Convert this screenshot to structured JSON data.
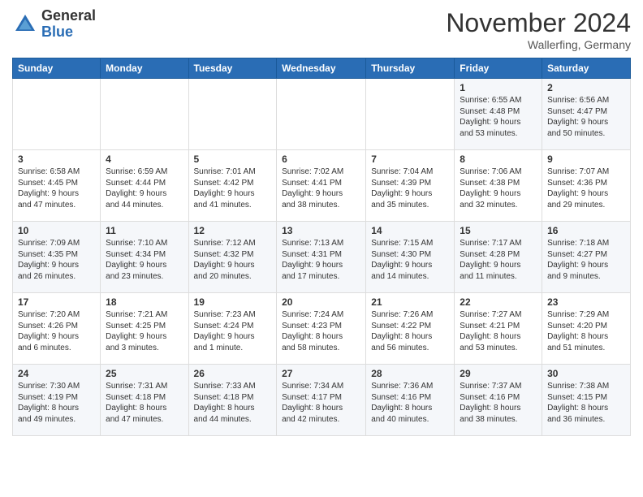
{
  "logo": {
    "general": "General",
    "blue": "Blue"
  },
  "title": "November 2024",
  "location": "Wallerfing, Germany",
  "days_of_week": [
    "Sunday",
    "Monday",
    "Tuesday",
    "Wednesday",
    "Thursday",
    "Friday",
    "Saturday"
  ],
  "weeks": [
    [
      {
        "day": "",
        "info": ""
      },
      {
        "day": "",
        "info": ""
      },
      {
        "day": "",
        "info": ""
      },
      {
        "day": "",
        "info": ""
      },
      {
        "day": "",
        "info": ""
      },
      {
        "day": "1",
        "info": "Sunrise: 6:55 AM\nSunset: 4:48 PM\nDaylight: 9 hours\nand 53 minutes."
      },
      {
        "day": "2",
        "info": "Sunrise: 6:56 AM\nSunset: 4:47 PM\nDaylight: 9 hours\nand 50 minutes."
      }
    ],
    [
      {
        "day": "3",
        "info": "Sunrise: 6:58 AM\nSunset: 4:45 PM\nDaylight: 9 hours\nand 47 minutes."
      },
      {
        "day": "4",
        "info": "Sunrise: 6:59 AM\nSunset: 4:44 PM\nDaylight: 9 hours\nand 44 minutes."
      },
      {
        "day": "5",
        "info": "Sunrise: 7:01 AM\nSunset: 4:42 PM\nDaylight: 9 hours\nand 41 minutes."
      },
      {
        "day": "6",
        "info": "Sunrise: 7:02 AM\nSunset: 4:41 PM\nDaylight: 9 hours\nand 38 minutes."
      },
      {
        "day": "7",
        "info": "Sunrise: 7:04 AM\nSunset: 4:39 PM\nDaylight: 9 hours\nand 35 minutes."
      },
      {
        "day": "8",
        "info": "Sunrise: 7:06 AM\nSunset: 4:38 PM\nDaylight: 9 hours\nand 32 minutes."
      },
      {
        "day": "9",
        "info": "Sunrise: 7:07 AM\nSunset: 4:36 PM\nDaylight: 9 hours\nand 29 minutes."
      }
    ],
    [
      {
        "day": "10",
        "info": "Sunrise: 7:09 AM\nSunset: 4:35 PM\nDaylight: 9 hours\nand 26 minutes."
      },
      {
        "day": "11",
        "info": "Sunrise: 7:10 AM\nSunset: 4:34 PM\nDaylight: 9 hours\nand 23 minutes."
      },
      {
        "day": "12",
        "info": "Sunrise: 7:12 AM\nSunset: 4:32 PM\nDaylight: 9 hours\nand 20 minutes."
      },
      {
        "day": "13",
        "info": "Sunrise: 7:13 AM\nSunset: 4:31 PM\nDaylight: 9 hours\nand 17 minutes."
      },
      {
        "day": "14",
        "info": "Sunrise: 7:15 AM\nSunset: 4:30 PM\nDaylight: 9 hours\nand 14 minutes."
      },
      {
        "day": "15",
        "info": "Sunrise: 7:17 AM\nSunset: 4:28 PM\nDaylight: 9 hours\nand 11 minutes."
      },
      {
        "day": "16",
        "info": "Sunrise: 7:18 AM\nSunset: 4:27 PM\nDaylight: 9 hours\nand 9 minutes."
      }
    ],
    [
      {
        "day": "17",
        "info": "Sunrise: 7:20 AM\nSunset: 4:26 PM\nDaylight: 9 hours\nand 6 minutes."
      },
      {
        "day": "18",
        "info": "Sunrise: 7:21 AM\nSunset: 4:25 PM\nDaylight: 9 hours\nand 3 minutes."
      },
      {
        "day": "19",
        "info": "Sunrise: 7:23 AM\nSunset: 4:24 PM\nDaylight: 9 hours\nand 1 minute."
      },
      {
        "day": "20",
        "info": "Sunrise: 7:24 AM\nSunset: 4:23 PM\nDaylight: 8 hours\nand 58 minutes."
      },
      {
        "day": "21",
        "info": "Sunrise: 7:26 AM\nSunset: 4:22 PM\nDaylight: 8 hours\nand 56 minutes."
      },
      {
        "day": "22",
        "info": "Sunrise: 7:27 AM\nSunset: 4:21 PM\nDaylight: 8 hours\nand 53 minutes."
      },
      {
        "day": "23",
        "info": "Sunrise: 7:29 AM\nSunset: 4:20 PM\nDaylight: 8 hours\nand 51 minutes."
      }
    ],
    [
      {
        "day": "24",
        "info": "Sunrise: 7:30 AM\nSunset: 4:19 PM\nDaylight: 8 hours\nand 49 minutes."
      },
      {
        "day": "25",
        "info": "Sunrise: 7:31 AM\nSunset: 4:18 PM\nDaylight: 8 hours\nand 47 minutes."
      },
      {
        "day": "26",
        "info": "Sunrise: 7:33 AM\nSunset: 4:18 PM\nDaylight: 8 hours\nand 44 minutes."
      },
      {
        "day": "27",
        "info": "Sunrise: 7:34 AM\nSunset: 4:17 PM\nDaylight: 8 hours\nand 42 minutes."
      },
      {
        "day": "28",
        "info": "Sunrise: 7:36 AM\nSunset: 4:16 PM\nDaylight: 8 hours\nand 40 minutes."
      },
      {
        "day": "29",
        "info": "Sunrise: 7:37 AM\nSunset: 4:16 PM\nDaylight: 8 hours\nand 38 minutes."
      },
      {
        "day": "30",
        "info": "Sunrise: 7:38 AM\nSunset: 4:15 PM\nDaylight: 8 hours\nand 36 minutes."
      }
    ]
  ]
}
